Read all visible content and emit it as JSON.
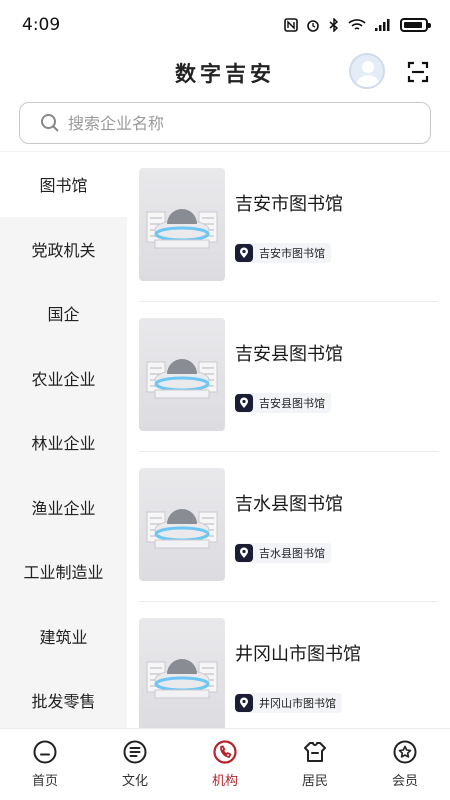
{
  "status_bar": {
    "time": "4:09"
  },
  "header": {
    "title": "数字吉安"
  },
  "search": {
    "placeholder": "搜索企业名称"
  },
  "sidebar": {
    "items": [
      {
        "label": "图书馆",
        "active": true
      },
      {
        "label": "党政机关"
      },
      {
        "label": "国企"
      },
      {
        "label": "农业企业"
      },
      {
        "label": "林业企业"
      },
      {
        "label": "渔业企业"
      },
      {
        "label": "工业制造业"
      },
      {
        "label": "建筑业"
      },
      {
        "label": "批发零售"
      }
    ]
  },
  "list": {
    "items": [
      {
        "title": "吉安市图书馆",
        "tag": "吉安市图书馆"
      },
      {
        "title": "吉安县图书馆",
        "tag": "吉安县图书馆"
      },
      {
        "title": "吉水县图书馆",
        "tag": "吉水县图书馆"
      },
      {
        "title": "井冈山市图书馆",
        "tag": "井冈山市图书馆"
      }
    ]
  },
  "bottom_nav": {
    "items": [
      {
        "label": "首页",
        "icon": "home-icon"
      },
      {
        "label": "文化",
        "icon": "culture-icon"
      },
      {
        "label": "机构",
        "icon": "institution-icon",
        "active": true
      },
      {
        "label": "居民",
        "icon": "resident-icon"
      },
      {
        "label": "会员",
        "icon": "member-icon"
      }
    ]
  },
  "colors": {
    "accent": "#b3262d",
    "tag_icon_bg": "#1a1d33",
    "sidebar_bg": "#f5f5f5"
  }
}
